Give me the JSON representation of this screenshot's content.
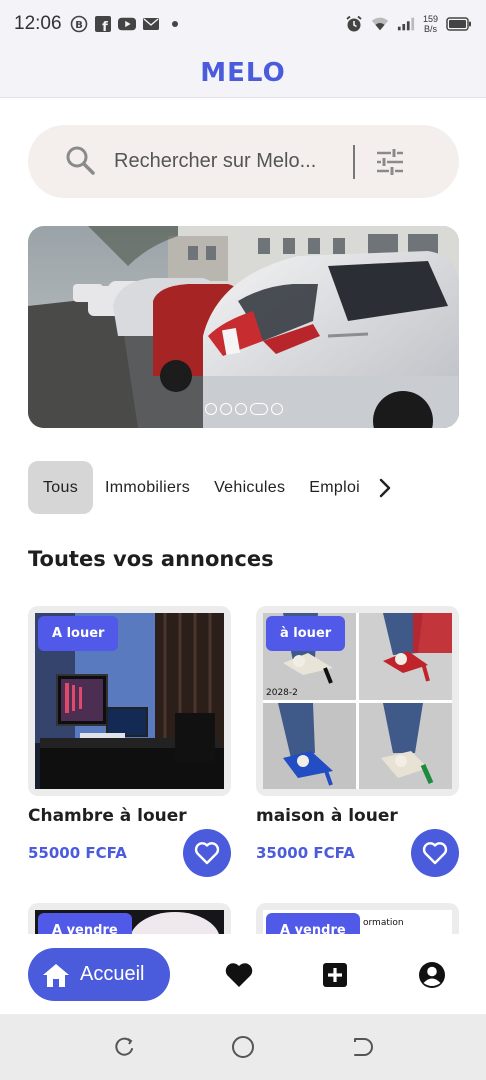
{
  "status_bar": {
    "time": "12:06",
    "net_speed_value": "159",
    "net_speed_unit": "B/s",
    "icons": [
      "b-circle-icon",
      "facebook-icon",
      "youtube-icon",
      "mail-icon",
      "dot-icon",
      "alarm-icon",
      "wifi-icon",
      "signal-icon",
      "battery-icon"
    ]
  },
  "header": {
    "logo": "MELO"
  },
  "search": {
    "placeholder": "Rechercher sur Melo..."
  },
  "banner": {
    "slide_count": 5,
    "active_slide": 4
  },
  "categories": [
    "Tous",
    "Immobiliers",
    "Vehicules",
    "Emploi"
  ],
  "active_category": "Tous",
  "section_title": "Toutes vos annonces",
  "listings": [
    {
      "badge": "A louer",
      "title": "Chambre à louer",
      "price": "55000 FCFA"
    },
    {
      "badge": "à louer",
      "title": "maison à louer",
      "price": "35000 FCFA",
      "image_caption": "2028-2"
    },
    {
      "badge": "A vendre"
    },
    {
      "badge": "A vendre",
      "image_caption": "ormation"
    }
  ],
  "bottom_nav": {
    "home_label": "Accueil"
  },
  "colors": {
    "accent": "#4a5bdc",
    "badge": "#5059e8",
    "search_bg": "#f4efed",
    "header_bg": "#f3f3f8"
  }
}
